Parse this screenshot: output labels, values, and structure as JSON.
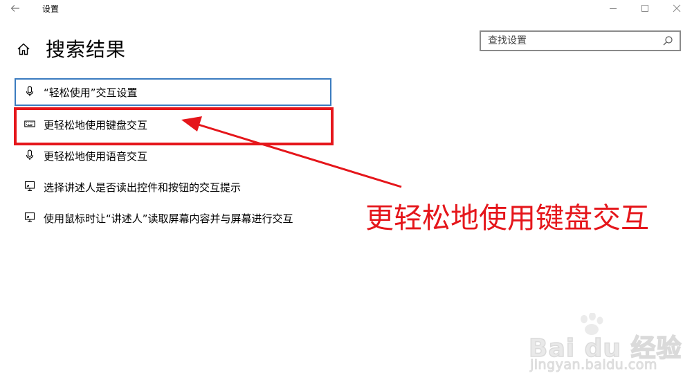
{
  "window": {
    "title": "设置"
  },
  "header": {
    "page_title": "搜索结果"
  },
  "search": {
    "placeholder": "查找设置",
    "value": ""
  },
  "results": [
    {
      "label": "“轻松使用”交互设置",
      "icon": "microphone-icon",
      "focused": true
    },
    {
      "label": "更轻松地使用键盘交互",
      "icon": "keyboard-icon",
      "focused": false
    },
    {
      "label": "更轻松地使用语音交互",
      "icon": "microphone-icon",
      "focused": false
    },
    {
      "label": "选择讲述人是否读出控件和按钮的交互提示",
      "icon": "narrator-monitor-icon",
      "focused": false
    },
    {
      "label": "使用鼠标时让“讲述人”读取屏幕内容并与屏幕进行交互",
      "icon": "narrator-monitor-icon",
      "focused": false
    }
  ],
  "annotation": {
    "text": "更轻松地使用键盘交互",
    "color": "#e5161b"
  },
  "watermark": {
    "main": "Bai du 经验",
    "sub": "jingyan.baidu.com"
  },
  "colors": {
    "focus_border": "#3a7bbf",
    "search_border": "#8a8a8a",
    "annotation_red": "#e5161b"
  }
}
